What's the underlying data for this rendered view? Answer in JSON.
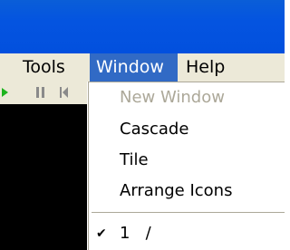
{
  "menubar": {
    "items": [
      {
        "label": "Tools"
      },
      {
        "label": "Window"
      },
      {
        "label": "Help"
      }
    ]
  },
  "window_menu": {
    "items": [
      {
        "label": "New Window",
        "enabled": false
      },
      {
        "label": "Cascade",
        "enabled": true
      },
      {
        "label": "Tile",
        "enabled": true
      },
      {
        "label": "Arrange Icons",
        "enabled": true
      },
      {
        "label": "1   /",
        "enabled": true,
        "checked": true,
        "check_glyph": "✔"
      }
    ]
  },
  "toolbar": {
    "icons": [
      "play-icon",
      "pause-icon",
      "skip-back-icon"
    ]
  },
  "colors": {
    "titlebar": "#0454e0",
    "menubar": "#ece9d8",
    "menu_highlight": "#316ac5",
    "disabled_text": "#aca899",
    "play_green": "#1db31d"
  }
}
